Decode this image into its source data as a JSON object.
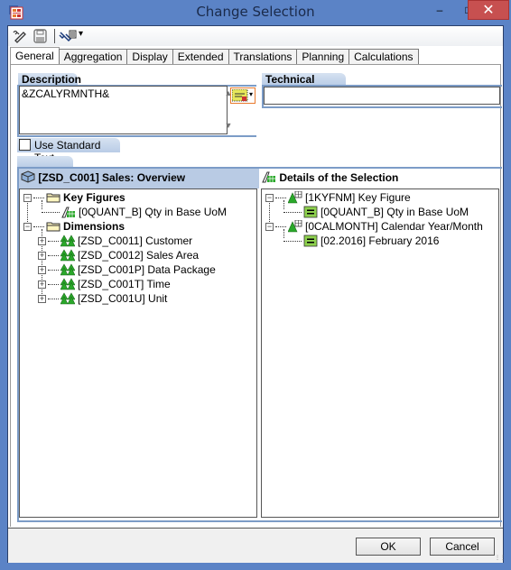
{
  "window": {
    "title": "Change Selection",
    "minimize_glyph": "‒",
    "maximize_glyph": "□",
    "close_glyph": "✕"
  },
  "toolbar": {
    "icons": [
      "edit-icon",
      "save-icon",
      "tools-dropdown-icon"
    ],
    "dropdown_glyph": "▾"
  },
  "tabs": [
    {
      "label": "General",
      "active": true
    },
    {
      "label": "Aggregation",
      "active": false
    },
    {
      "label": "Display",
      "active": false
    },
    {
      "label": "Extended",
      "active": false
    },
    {
      "label": "Translations",
      "active": false
    },
    {
      "label": "Planning",
      "active": false
    },
    {
      "label": "Calculations",
      "active": false
    }
  ],
  "general": {
    "description_label": "Description",
    "description_value": "&ZCALYRMNTH&",
    "technical_name_label": "Technical Name",
    "technical_name_value": "",
    "use_standard_text_label": "Use Standard Text",
    "use_standard_text_checked": false
  },
  "left_pane": {
    "title": "[ZSD_C001] Sales: Overview",
    "tree": [
      {
        "label": "Key Figures",
        "bold": true,
        "icon": "folder-icon",
        "expanded": true,
        "children": [
          {
            "label": "[0QUANT_B] Qty in Base UoM",
            "icon": "key-figure-icon"
          }
        ]
      },
      {
        "label": "Dimensions",
        "bold": true,
        "icon": "folder-icon",
        "expanded": true,
        "children": [
          {
            "label": "[ZSD_C0011] Customer",
            "icon": "dimension-icon"
          },
          {
            "label": "[ZSD_C0012] Sales Area",
            "icon": "dimension-icon"
          },
          {
            "label": "[ZSD_C001P] Data Package",
            "icon": "dimension-icon"
          },
          {
            "label": "[ZSD_C001T] Time",
            "icon": "dimension-icon"
          },
          {
            "label": "[ZSD_C001U] Unit",
            "icon": "dimension-icon"
          }
        ]
      }
    ]
  },
  "right_pane": {
    "title": "Details of the Selection",
    "tree": [
      {
        "label": "[1KYFNM] Key Figure",
        "icon": "characteristic-icon",
        "expanded": true,
        "children": [
          {
            "label": "[0QUANT_B] Qty in Base UoM",
            "icon": "equals-icon"
          }
        ]
      },
      {
        "label": "[0CALMONTH] Calendar Year/Month",
        "icon": "characteristic-icon",
        "expanded": true,
        "children": [
          {
            "label": "[02.2016] February 2016",
            "icon": "equals-icon"
          }
        ]
      }
    ]
  },
  "footer": {
    "ok_label": "OK",
    "cancel_label": "Cancel"
  },
  "colors": {
    "titlebar": "#5b83c6",
    "close_button": "#c75050",
    "group_header": "#b9cbe4",
    "frame_border": "#7c9cc7",
    "variable_button_border": "#e87a2d"
  }
}
